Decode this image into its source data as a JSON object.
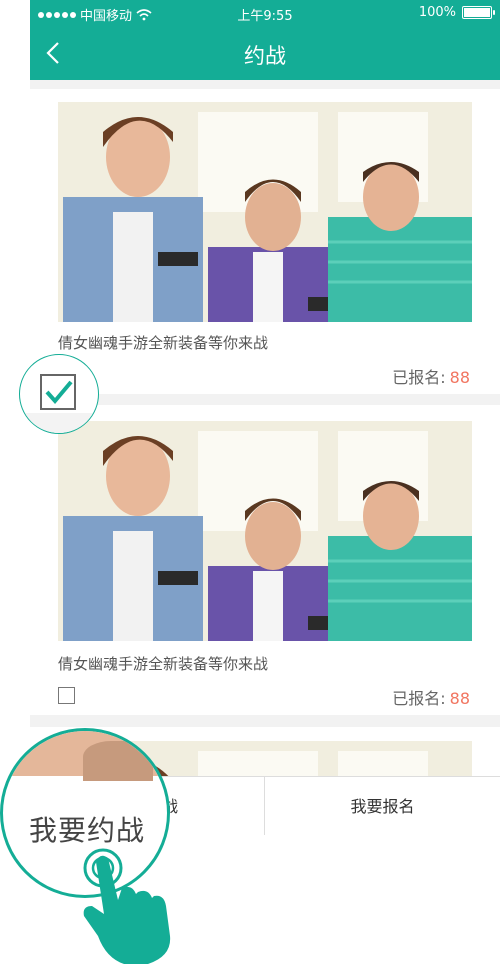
{
  "status_bar": {
    "carrier": "中国移动",
    "time": "上午9:55",
    "battery": "100%"
  },
  "header": {
    "title": "约战"
  },
  "cards": [
    {
      "title": "倩女幽魂手游全新装备等你来战",
      "signup_label": "已报名:",
      "signup_count": "88",
      "checked": true
    },
    {
      "title": "倩女幽魂手游全新装备等你来战",
      "signup_label": "已报名:",
      "signup_count": "88",
      "checked": false
    }
  ],
  "bottom_bar": {
    "left_button": "我要约战",
    "left_button_visible": "战",
    "right_button": "我要报名"
  },
  "magnifier": {
    "label": "我要约战"
  },
  "colors": {
    "brand": "#14ad96",
    "count": "#f17560"
  }
}
